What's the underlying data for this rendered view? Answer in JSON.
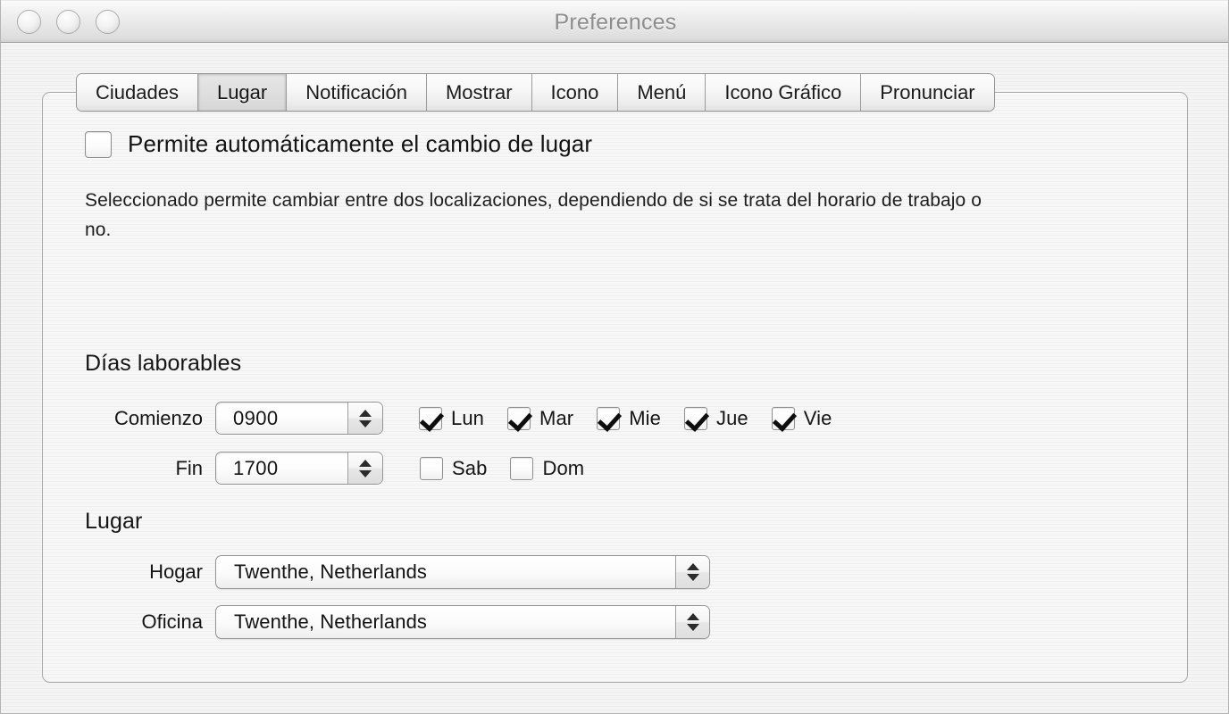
{
  "window": {
    "title": "Preferences",
    "traffic_lights": [
      {
        "name": "close-button",
        "color": "#e3e3e3"
      },
      {
        "name": "minimize-button",
        "color": "#e3e3e3"
      },
      {
        "name": "zoom-button",
        "color": "#e3e3e3"
      }
    ]
  },
  "tabs": [
    {
      "label": "Ciudades",
      "selected": false
    },
    {
      "label": "Lugar",
      "selected": true
    },
    {
      "label": "Notificación",
      "selected": false
    },
    {
      "label": "Mostrar",
      "selected": false
    },
    {
      "label": "Icono",
      "selected": false
    },
    {
      "label": "Menú",
      "selected": false
    },
    {
      "label": "Icono Gráfico",
      "selected": false
    },
    {
      "label": "Pronunciar",
      "selected": false
    }
  ],
  "auto_switch": {
    "label": "Permite automáticamente el cambio de lugar",
    "checked": false
  },
  "description": "Seleccionado permite cambiar entre dos localizaciones, dependiendo de si se trata del horario de trabajo o no.",
  "workdays": {
    "section_title": "Días laborables",
    "start": {
      "label": "Comienzo",
      "value": "0900"
    },
    "end": {
      "label": "Fin",
      "value": "1700"
    },
    "weekdays": [
      {
        "label": "Lun",
        "checked": true
      },
      {
        "label": "Mar",
        "checked": true
      },
      {
        "label": "Mie",
        "checked": true
      },
      {
        "label": "Jue",
        "checked": true
      },
      {
        "label": "Vie",
        "checked": true
      }
    ],
    "weekend": [
      {
        "label": "Sab",
        "checked": false
      },
      {
        "label": "Dom",
        "checked": false
      }
    ]
  },
  "place": {
    "section_title": "Lugar",
    "home": {
      "label": "Hogar",
      "value": "Twenthe, Netherlands"
    },
    "office": {
      "label": "Oficina",
      "value": "Twenthe, Netherlands"
    }
  },
  "colors": {
    "window_background": "#f2f2f2",
    "text": "#131313",
    "title_text": "#8d8d8d",
    "border": "#a8a8a8"
  }
}
